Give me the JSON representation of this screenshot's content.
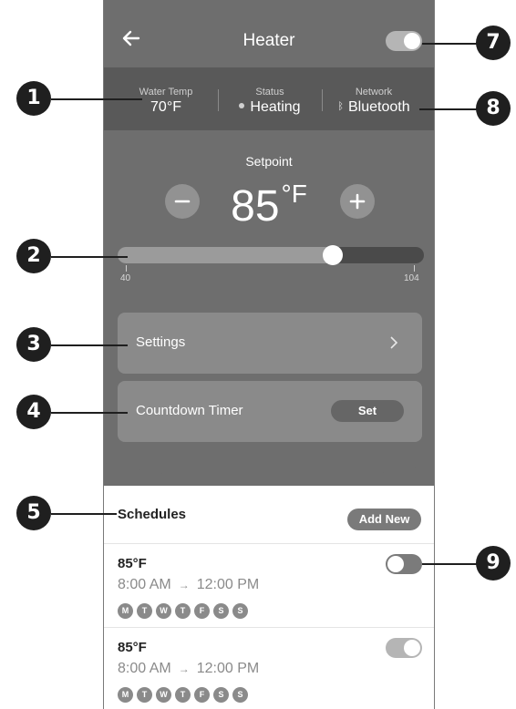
{
  "header": {
    "title": "Heater",
    "power_on": true
  },
  "status": {
    "water_temp": {
      "label": "Water Temp",
      "value": "70°F"
    },
    "state": {
      "label": "Status",
      "value": "Heating"
    },
    "network": {
      "label": "Network",
      "value": "Bluetooth"
    }
  },
  "setpoint": {
    "label": "Setpoint",
    "value": "85",
    "unit": "°F",
    "minus_label": "−",
    "plus_label": "+",
    "slider": {
      "min_label": "40",
      "max_label": "104",
      "min": 40,
      "max": 104,
      "value": 85
    }
  },
  "menu": {
    "settings_label": "Settings",
    "timer_label": "Countdown Timer",
    "timer_button": "Set"
  },
  "schedules": {
    "title": "Schedules",
    "add_label": "Add New",
    "items": [
      {
        "temp": "85°F",
        "start": "8:00 AM",
        "end": "12:00 PM",
        "enabled": false,
        "days": [
          "M",
          "T",
          "W",
          "T",
          "F",
          "S",
          "S"
        ]
      },
      {
        "temp": "85°F",
        "start": "8:00 AM",
        "end": "12:00 PM",
        "enabled": true,
        "days": [
          "M",
          "T",
          "W",
          "T",
          "F",
          "S",
          "S"
        ]
      }
    ]
  },
  "callouts": [
    "1",
    "2",
    "3",
    "4",
    "5",
    "7",
    "8",
    "9"
  ],
  "colors": {
    "header": "#6e6e6e",
    "status_bar": "#595959",
    "card": "#8a8a8a",
    "callout": "#1f1f1f"
  }
}
